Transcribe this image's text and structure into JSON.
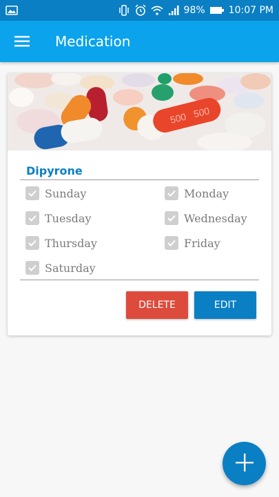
{
  "status_bar": {
    "battery_percent": "98%",
    "time": "10:07 PM",
    "icons": [
      "image-icon",
      "vibrate-icon",
      "alarm-icon",
      "wifi-icon",
      "signal-icon",
      "battery-icon"
    ]
  },
  "app_bar": {
    "title": "Medication",
    "menu_icon": "hamburger-menu-icon"
  },
  "medications": [
    {
      "name": "Dipyrone",
      "image": "pills-photo",
      "days": [
        {
          "label": "Sunday",
          "checked": true
        },
        {
          "label": "Monday",
          "checked": true
        },
        {
          "label": "Tuesday",
          "checked": true
        },
        {
          "label": "Wednesday",
          "checked": true
        },
        {
          "label": "Thursday",
          "checked": true
        },
        {
          "label": "Friday",
          "checked": true
        },
        {
          "label": "Saturday",
          "checked": true
        }
      ],
      "delete_label": "DELETE",
      "edit_label": "EDIT"
    }
  ],
  "fab": {
    "icon": "plus-icon"
  },
  "colors": {
    "status_bar": "#0a7fc4",
    "app_bar": "#0ba3ec",
    "primary": "#0a7fc4",
    "delete": "#dd4b3c"
  }
}
